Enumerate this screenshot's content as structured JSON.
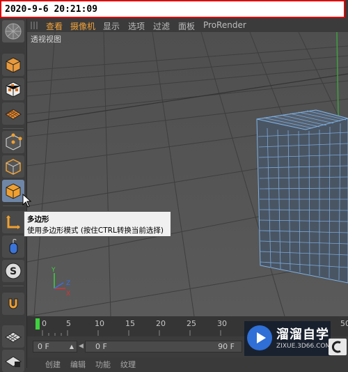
{
  "timestamp": "2020-9-6 20:21:09",
  "menu": {
    "items": [
      "查看",
      "摄像机",
      "显示",
      "选项",
      "过滤",
      "面板",
      "ProRender"
    ],
    "highlight_color": "#f2a23a"
  },
  "viewport": {
    "label": "透视视图"
  },
  "toolbar": {
    "items": [
      "cube-tool",
      "checker-cube-tool",
      "grid-plane-tool",
      "point-mode-tool",
      "edge-mode-tool",
      "polygon-mode-tool",
      "axis-tool",
      "mouse-tool",
      "snap-s-tool",
      "magnet-tool",
      "grid-lock-tool"
    ]
  },
  "tooltip": {
    "title": "多边形",
    "description": "使用多边形模式 (按住CTRL转换当前选择)"
  },
  "timeline": {
    "ticks": [
      "0",
      "5",
      "10",
      "15",
      "20",
      "25",
      "30",
      "50"
    ]
  },
  "controls": {
    "frame_field": "0 F",
    "range_start": "0 F",
    "range_end": "90 F"
  },
  "bottom_tabs": [
    "创建",
    "编辑",
    "功能",
    "纹理"
  ],
  "watermark": {
    "name": "溜溜自学",
    "site": "ZIXUE.3D66.COM"
  },
  "colors": {
    "stamp_border": "#e00000",
    "active_tool": "#6f86a6",
    "mesh": "#7fb3e8"
  }
}
